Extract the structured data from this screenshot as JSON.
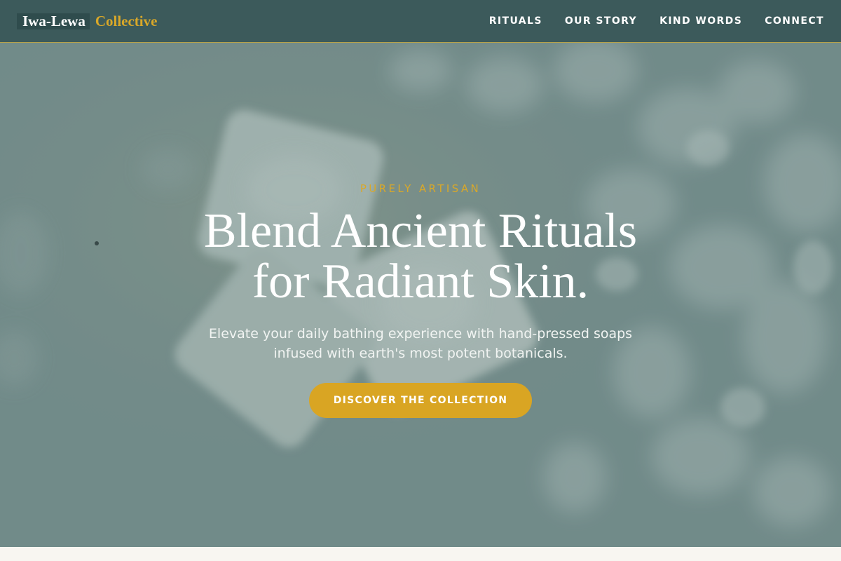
{
  "brand": {
    "primary": "Iwa-Lewa",
    "accent": "Collective"
  },
  "nav": {
    "items": [
      {
        "label": "RITUALS"
      },
      {
        "label": "OUR STORY"
      },
      {
        "label": "KIND WORDS"
      },
      {
        "label": "CONNECT"
      }
    ]
  },
  "hero": {
    "eyebrow": "PURELY ARTISAN",
    "headline_line1": "Blend Ancient Rituals",
    "headline_line2": "for Radiant Skin.",
    "subtext_line1": "Elevate your daily bathing experience with hand-pressed soaps",
    "subtext_line2": "infused with earth's most potent botanicals.",
    "cta_label": "DISCOVER THE COLLECTION",
    "background_image": "handmade-soap-bars-photo"
  },
  "colors": {
    "nav_bg": "#3c5a5b",
    "accent_gold": "#d9a829",
    "hero_tint": "#7e9492",
    "page_bg": "#f8f6f1"
  }
}
